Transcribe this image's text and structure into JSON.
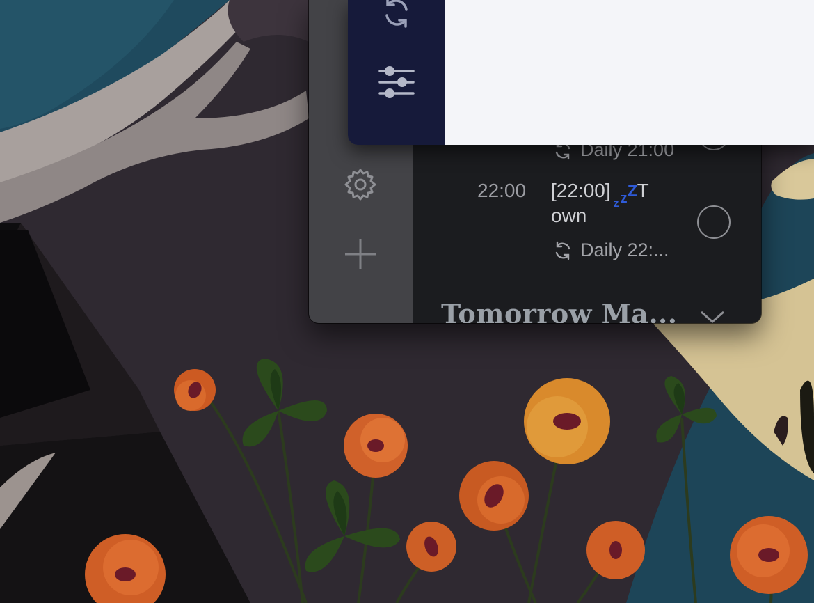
{
  "colors": {
    "accent_snooze": "#2f5bd8",
    "rail": "#434347",
    "content_bg": "#1b1c1f",
    "popup_rail": "#161a3a",
    "popup_bg": "#f4f5f9"
  },
  "popup": {
    "rail_icons": [
      "sync-icon",
      "sliders-icon"
    ]
  },
  "main": {
    "rail_icons": [
      "gear-icon",
      "plus-icon"
    ],
    "partial_row": {
      "repeat_label": "Daily 21:00"
    },
    "row": {
      "time": "22:00",
      "title_line1": "[22:00]",
      "title_line1_suffix": "T",
      "title_line2": "own",
      "snooze_icon": "zzz-icon",
      "repeat_label": "Daily 22:..."
    },
    "section": {
      "title": "Tomorrow Ma...",
      "toggle_icon": "chevron-down-icon"
    }
  }
}
